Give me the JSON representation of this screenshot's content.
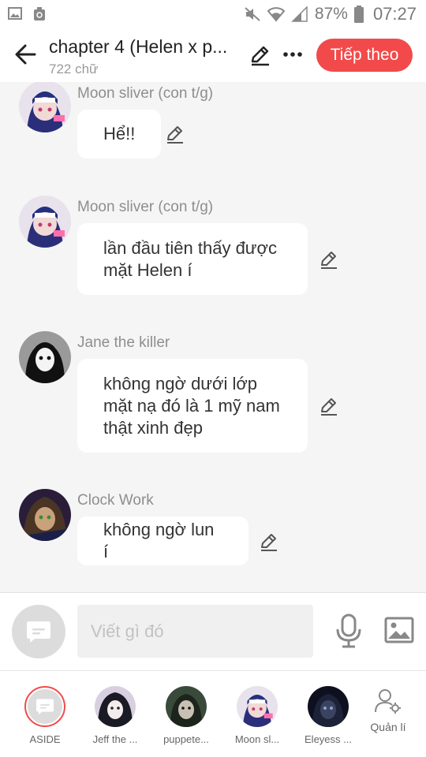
{
  "status_bar": {
    "battery": "87%",
    "time": "07:27"
  },
  "header": {
    "title": "chapter 4 (Helen x p...",
    "word_count": "722 chữ",
    "next_label": "Tiếp theo"
  },
  "messages": [
    {
      "sender": "Moon sliver (con t/g)",
      "text": "Hể!!"
    },
    {
      "sender": "Moon sliver (con t/g)",
      "text": "lần đầu tiên thấy được mặt Helen í"
    },
    {
      "sender": "Jane the killer",
      "text": "không ngờ dưới lớp mặt nạ đó là 1 mỹ nam thật xinh đẹp"
    },
    {
      "sender": "Clock Work",
      "text": "không ngờ lun í"
    }
  ],
  "input": {
    "placeholder": "Viết gì đó"
  },
  "characters": [
    {
      "label": "ASIDE"
    },
    {
      "label": "Jeff the ..."
    },
    {
      "label": "puppete..."
    },
    {
      "label": "Moon sl..."
    },
    {
      "label": "Eleyess ..."
    }
  ],
  "manage": {
    "label": "Quản lí"
  },
  "colors": {
    "accent": "#f24a4a",
    "chat_bg": "#f5f5f5",
    "sender_text": "#8e8e8e"
  }
}
